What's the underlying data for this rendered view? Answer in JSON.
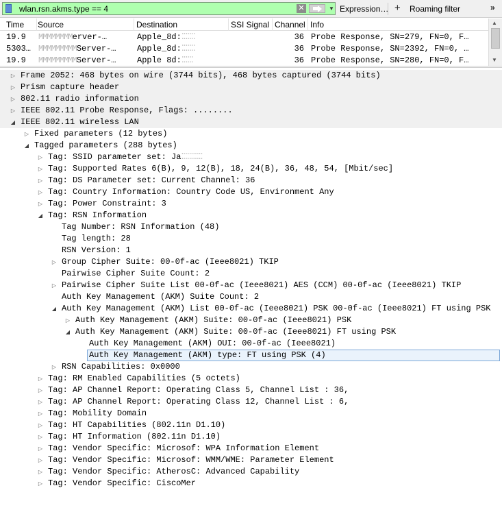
{
  "filter": {
    "value": "wlan.rsn.akms.type == 4",
    "expression_label": "Expression…",
    "roaming_label": "Roaming filter",
    "plus_glyph": "+",
    "overflow_glyph": "»"
  },
  "packet_list": {
    "columns": [
      "Time",
      "Source",
      "Destination",
      "SSI Signal",
      "Channel",
      "Info"
    ],
    "rows": [
      {
        "time": "19.9",
        "src_blur": "MMMMMMMM",
        "src": "erver-…",
        "dst": "Apple_8d:",
        "dst_blur": "⁚⁚⁚⁚⁚⁚⁚",
        "signal": "",
        "channel": "36",
        "info": "Probe Response, SN=279, FN=0, F…"
      },
      {
        "time": "5303…",
        "src_blur": "MMMMMMMMM",
        "src": "Server-…",
        "dst": "Apple_8d:",
        "dst_blur": "⁚⁚⁚⁚⁚⁚⁚",
        "signal": "",
        "channel": "36",
        "info": "Probe Response, SN=2392, FN=0, …"
      },
      {
        "time": "19.9",
        "src_blur": "MMMMMMMMM",
        "src": "Server-…",
        "dst": "Apple 8d:",
        "dst_blur": "⁚⁚⁚⁚⁚⁚",
        "signal": "",
        "channel": "36",
        "info": "Probe Response, SN=280, FN=0, F…"
      }
    ]
  },
  "tree": [
    {
      "text": "Frame 2052: 468 bytes on wire (3744 bits), 468 bytes captured (3744 bits)",
      "state": "closed",
      "level": 0
    },
    {
      "text": "Prism capture header",
      "state": "closed",
      "level": 0
    },
    {
      "text": "802.11 radio information",
      "state": "closed",
      "level": 0
    },
    {
      "text": "IEEE 802.11 Probe Response, Flags: ........",
      "state": "closed",
      "level": 0
    },
    {
      "text": "IEEE 802.11 wireless LAN",
      "state": "open",
      "level": 0
    },
    {
      "text": "Fixed parameters (12 bytes)",
      "state": "closed",
      "level": 1
    },
    {
      "text": "Tagged parameters (288 bytes)",
      "state": "open",
      "level": 1
    },
    {
      "text": "Tag: SSID parameter set: Ja",
      "blur": "⁚⁚⁚⁚⁚⁚⁚⁚⁚⁚⁚",
      "state": "closed",
      "level": 2
    },
    {
      "text": "Tag: Supported Rates 6(B), 9, 12(B), 18, 24(B), 36, 48, 54, [Mbit/sec]",
      "state": "closed",
      "level": 2
    },
    {
      "text": "Tag: DS Parameter set: Current Channel: 36",
      "state": "closed",
      "level": 2
    },
    {
      "text": "Tag: Country Information: Country Code US, Environment Any",
      "state": "closed",
      "level": 2
    },
    {
      "text": "Tag: Power Constraint: 3",
      "state": "closed",
      "level": 2
    },
    {
      "text": "Tag: RSN Information",
      "state": "open",
      "level": 2
    },
    {
      "text": "Tag Number: RSN Information (48)",
      "state": "leaf",
      "level": 3
    },
    {
      "text": "Tag length: 28",
      "state": "leaf",
      "level": 3
    },
    {
      "text": "RSN Version: 1",
      "state": "leaf",
      "level": 3
    },
    {
      "text": "Group Cipher Suite: 00-0f-ac (Ieee8021) TKIP",
      "state": "closed",
      "level": 3
    },
    {
      "text": "Pairwise Cipher Suite Count: 2",
      "state": "leaf",
      "level": 3
    },
    {
      "text": "Pairwise Cipher Suite List 00-0f-ac (Ieee8021) AES (CCM) 00-0f-ac (Ieee8021) TKIP",
      "state": "closed",
      "level": 3
    },
    {
      "text": "Auth Key Management (AKM) Suite Count: 2",
      "state": "leaf",
      "level": 3
    },
    {
      "text": "Auth Key Management (AKM) List 00-0f-ac (Ieee8021) PSK 00-0f-ac (Ieee8021) FT using PSK",
      "state": "open",
      "level": 3
    },
    {
      "text": "Auth Key Management (AKM) Suite: 00-0f-ac (Ieee8021) PSK",
      "state": "closed",
      "level": 4
    },
    {
      "text": "Auth Key Management (AKM) Suite: 00-0f-ac (Ieee8021) FT using PSK",
      "state": "open",
      "level": 4
    },
    {
      "text": "Auth Key Management (AKM) OUI: 00-0f-ac (Ieee8021)",
      "state": "leaf",
      "level": 5
    },
    {
      "text": "Auth Key Management (AKM) type: FT using PSK (4)",
      "state": "leaf",
      "level": 5,
      "selected": true
    },
    {
      "text": "RSN Capabilities: 0x0000",
      "state": "closed",
      "level": 3
    },
    {
      "text": "Tag: RM Enabled Capabilities (5 octets)",
      "state": "closed",
      "level": 2
    },
    {
      "text": "Tag: AP Channel Report: Operating Class 5, Channel List : 36,",
      "state": "closed",
      "level": 2
    },
    {
      "text": "Tag: AP Channel Report: Operating Class 12, Channel List : 6,",
      "state": "closed",
      "level": 2
    },
    {
      "text": "Tag: Mobility Domain",
      "state": "closed",
      "level": 2
    },
    {
      "text": "Tag: HT Capabilities (802.11n D1.10)",
      "state": "closed",
      "level": 2
    },
    {
      "text": "Tag: HT Information (802.11n D1.10)",
      "state": "closed",
      "level": 2
    },
    {
      "text": "Tag: Vendor Specific: Microsof: WPA Information Element",
      "state": "closed",
      "level": 2
    },
    {
      "text": "Tag: Vendor Specific: Microsof: WMM/WME: Parameter Element",
      "state": "closed",
      "level": 2
    },
    {
      "text": "Tag: Vendor Specific: AtherosC: Advanced Capability",
      "state": "closed",
      "level": 2
    },
    {
      "text": "Tag: Vendor Specific: CiscoMer",
      "state": "closed",
      "level": 2
    }
  ],
  "glyphs": {
    "closed": "▷",
    "open": "◢"
  },
  "colors": {
    "filter_valid": "#afffaf",
    "section_shade": "#f0f0f0",
    "selection_border": "#7aa7d8"
  }
}
